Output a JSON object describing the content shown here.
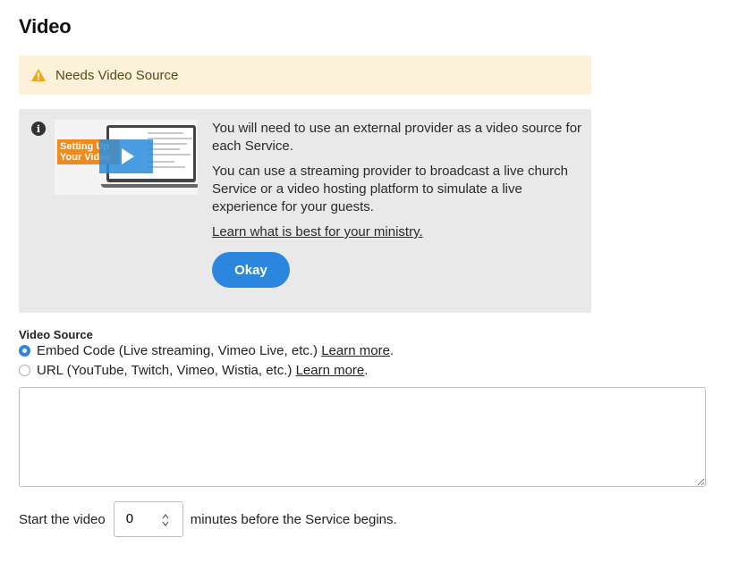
{
  "page": {
    "title": "Video"
  },
  "warning": {
    "text": "Needs Video Source",
    "icon": "warning-triangle-icon",
    "color": "#f2a51a"
  },
  "info": {
    "icon": "info-icon",
    "thumbnail_caption": "Setting Up Your Video",
    "paragraph1": "You will need to use an external provider as a video source for each Service.",
    "paragraph2": "You can use a streaming provider to broadcast a live church Service or a video hosting platform to simulate a live experience for your guests.",
    "link": "Learn what is best for your ministry.",
    "okay_label": "Okay"
  },
  "video_source": {
    "label": "Video Source",
    "options": [
      {
        "text": "Embed Code (Live streaming, Vimeo Live, etc.)",
        "link": "Learn more",
        "suffix": ".",
        "selected": true
      },
      {
        "text": "URL (YouTube, Twitch, Vimeo, Wistia, etc.)",
        "link": "Learn more",
        "suffix": ".",
        "selected": false
      }
    ],
    "embed_value": ""
  },
  "start": {
    "prefix": "Start the video",
    "minutes": "0",
    "suffix": "minutes before the Service begins."
  },
  "colors": {
    "accent": "#2b87dd",
    "warning_bg": "#fcf1d9",
    "panel_bg": "#e9e9e9"
  }
}
